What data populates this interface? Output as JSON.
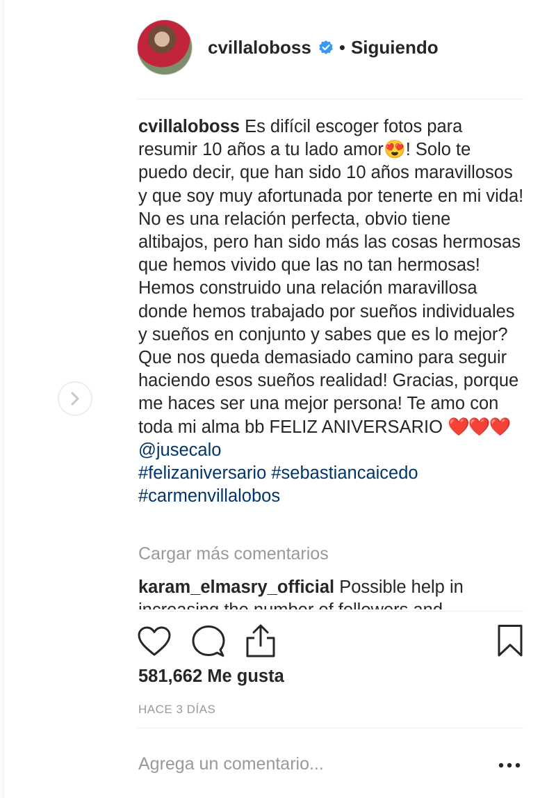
{
  "header": {
    "username": "cvillaloboss",
    "separator": "•",
    "follow_status": "Siguiendo"
  },
  "caption": {
    "username": "cvillaloboss",
    "text_before_emoji": "Es difícil escoger fotos para resumir 10 años a tu lado amor",
    "emoji": "😍",
    "text_after_emoji": "! Solo te puedo decir, que han sido 10 años maravillosos y que soy muy afortunada por tenerte en mi vida! No es una relación perfecta, obvio tiene altibajos, pero han sido más las cosas hermosas que hemos vivido que las no tan hermosas! Hemos construido una relación maravillosa donde hemos trabajado por sueños individuales y sueños en conjunto y sabes que es lo mejor? Que nos queda demasiado camino para seguir haciendo esos sueños realidad! Gracias, porque me haces ser una mejor persona! Te amo con toda mi alma bb FELIZ ANIVERSARIO ",
    "hearts": "❤️❤️❤️",
    "mention": "@jusecalo",
    "hashtag_1": "#felizaniversario",
    "hashtag_2": "#sebastiancaicedo",
    "hashtag_3": "#carmenvillalobos"
  },
  "load_more_label": "Cargar más comentarios",
  "comment": {
    "username": "karam_elmasry_official",
    "text": "Possible help in increasing the number of followers and"
  },
  "actions": {
    "like_icon": "heart-icon",
    "comment_icon": "comment-icon",
    "share_icon": "share-icon",
    "save_icon": "bookmark-icon"
  },
  "likes_label": "581,662 Me gusta",
  "timestamp": "hace 3 días",
  "comment_box": {
    "placeholder": "Agrega un comentario...",
    "more_label": "•••"
  },
  "colors": {
    "link": "#003569",
    "verified": "#3897f0",
    "muted": "#999999",
    "text": "#262626"
  }
}
